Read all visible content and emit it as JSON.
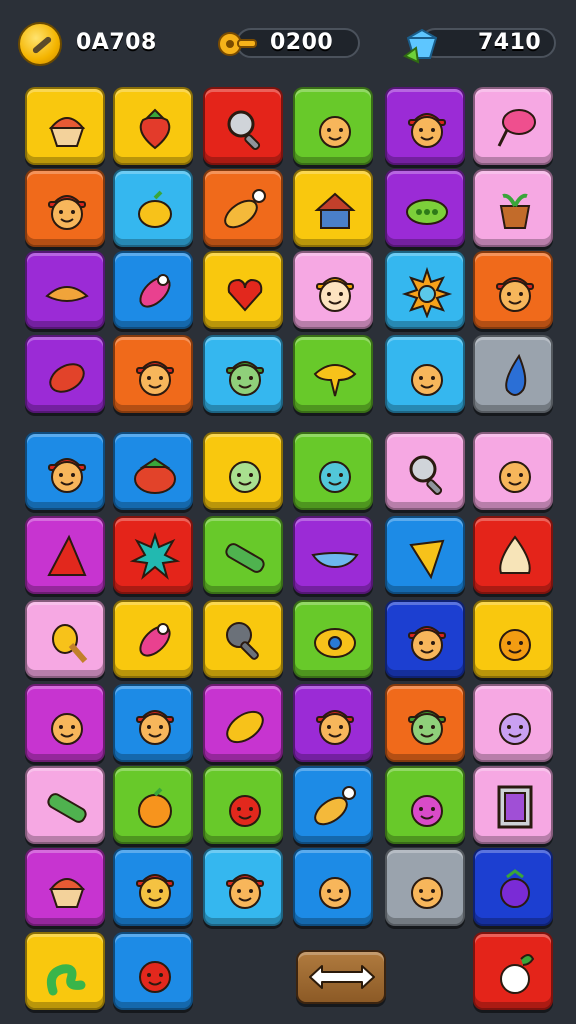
{
  "hud": {
    "coins": "0A708",
    "keys": "0200",
    "gems": "7410"
  },
  "colors": {
    "yellow": "#f9c80e",
    "red": "#e4241a",
    "green": "#68c92a",
    "purple": "#9b2bd6",
    "pink": "#f6a8e3",
    "orange": "#f06a1b",
    "blue": "#1d8be6",
    "cyan": "#35b7ef",
    "gray": "#9aa3ad",
    "darkblue": "#1c3fd1",
    "magenta": "#c734d0",
    "brown": "#9c6a36"
  },
  "tiles": [
    {
      "color": "yellow",
      "icon": "cupcake-icon"
    },
    {
      "color": "yellow",
      "icon": "strawberry-icon"
    },
    {
      "color": "red",
      "icon": "magnifier-icon"
    },
    {
      "color": "green",
      "icon": "face-icon"
    },
    {
      "color": "purple",
      "icon": "face-hat-icon"
    },
    {
      "color": "pink",
      "icon": "pin-icon"
    },
    {
      "color": "orange",
      "icon": "face-hat-icon"
    },
    {
      "color": "cyan",
      "icon": "lemon-icon"
    },
    {
      "color": "orange",
      "icon": "leaf-brush-icon"
    },
    {
      "color": "yellow",
      "icon": "house-icon"
    },
    {
      "color": "purple",
      "icon": "pod-icon"
    },
    {
      "color": "pink",
      "icon": "plant-pot-icon"
    },
    {
      "color": "purple",
      "icon": "taco-icon"
    },
    {
      "color": "blue",
      "icon": "rocket-icon"
    },
    {
      "color": "yellow",
      "icon": "heart-tools-icon"
    },
    {
      "color": "pink",
      "icon": "face-hardhat-icon"
    },
    {
      "color": "cyan",
      "icon": "sun-icon"
    },
    {
      "color": "orange",
      "icon": "face-hat-icon"
    },
    {
      "color": "purple",
      "icon": "seed-icon"
    },
    {
      "color": "orange",
      "icon": "face-hat-icon"
    },
    {
      "color": "cyan",
      "icon": "zombie-hat-icon"
    },
    {
      "color": "green",
      "icon": "speech-bubble-icon"
    },
    {
      "color": "cyan",
      "icon": "face-icon"
    },
    {
      "color": "gray",
      "icon": "drop-icon"
    },
    {
      "color": "blue",
      "icon": "face-hat-icon"
    },
    {
      "color": "blue",
      "icon": "tomato-icon"
    },
    {
      "color": "yellow",
      "icon": "zombie-icon"
    },
    {
      "color": "green",
      "icon": "alien-icon"
    },
    {
      "color": "pink",
      "icon": "magnifier-icon"
    },
    {
      "color": "pink",
      "icon": "face-icon"
    },
    {
      "color": "magenta",
      "icon": "wedge-icon"
    },
    {
      "color": "red",
      "icon": "splat-icon"
    },
    {
      "color": "green",
      "icon": "tube-icon"
    },
    {
      "color": "purple",
      "icon": "boat-icon"
    },
    {
      "color": "blue",
      "icon": "shell-icon"
    },
    {
      "color": "red",
      "icon": "onion-icon"
    },
    {
      "color": "pink",
      "icon": "bird-icon"
    },
    {
      "color": "yellow",
      "icon": "rocket-icon"
    },
    {
      "color": "yellow",
      "icon": "wrench-icon"
    },
    {
      "color": "green",
      "icon": "eye-icon"
    },
    {
      "color": "darkblue",
      "icon": "face-hat-icon"
    },
    {
      "color": "yellow",
      "icon": "orange-face-icon"
    },
    {
      "color": "magenta",
      "icon": "face-icon"
    },
    {
      "color": "blue",
      "icon": "face-hat-icon"
    },
    {
      "color": "magenta",
      "icon": "mango-icon"
    },
    {
      "color": "purple",
      "icon": "face-hat-icon"
    },
    {
      "color": "orange",
      "icon": "zombie-hat-icon"
    },
    {
      "color": "pink",
      "icon": "radish-face-icon"
    },
    {
      "color": "pink",
      "icon": "tube-icon"
    },
    {
      "color": "green",
      "icon": "orange-fruit-icon"
    },
    {
      "color": "green",
      "icon": "monster-icon"
    },
    {
      "color": "blue",
      "icon": "leaf-brush-icon"
    },
    {
      "color": "green",
      "icon": "blob-face-icon"
    },
    {
      "color": "pink",
      "icon": "frame-icon"
    },
    {
      "color": "magenta",
      "icon": "cupcake-icon"
    },
    {
      "color": "blue",
      "icon": "melon-face-icon"
    },
    {
      "color": "cyan",
      "icon": "face-hat-icon"
    },
    {
      "color": "blue",
      "icon": "face-icon"
    },
    {
      "color": "gray",
      "icon": "face-icon"
    },
    {
      "color": "darkblue",
      "icon": "berry-icon"
    },
    {
      "color": "yellow",
      "icon": "worm-icon"
    },
    {
      "color": "blue",
      "icon": "devil-face-icon"
    },
    null,
    null,
    null,
    {
      "color": "red",
      "icon": "bunny-icon"
    }
  ],
  "controls": {
    "arrow": "double-arrow-icon"
  }
}
